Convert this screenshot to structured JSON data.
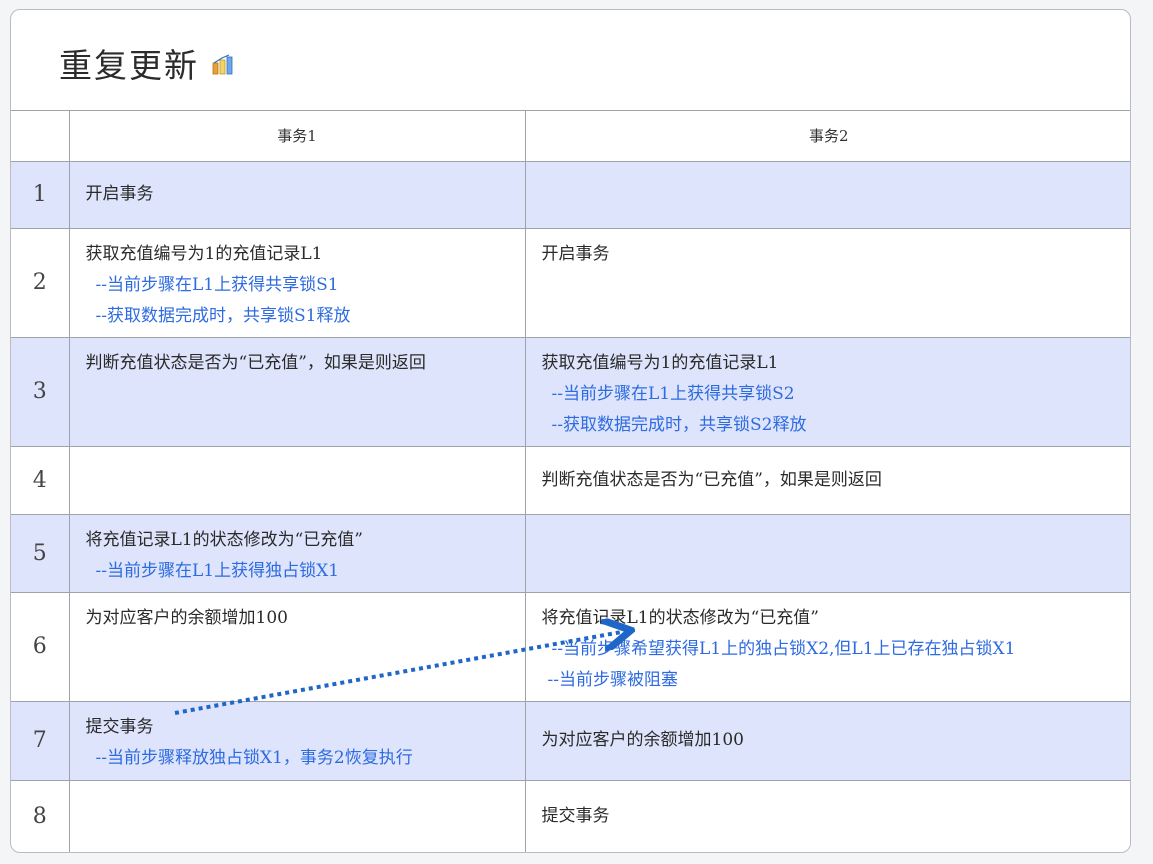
{
  "title": "重复更新",
  "title_icon": "bar-chart-icon",
  "colors": {
    "shaded_row": "#dde4fb",
    "note_text": "#2e6be0",
    "arrow": "#1f66c9"
  },
  "headers": {
    "num": "",
    "tx1": "事务1",
    "tx2": "事务2"
  },
  "rows": [
    {
      "num": "1",
      "tx1": [
        "开启事务"
      ],
      "tx2": []
    },
    {
      "num": "2",
      "tx1": [
        "获取充值编号为1的充值记录L1",
        "--当前步骤在L1上获得共享锁S1",
        "--获取数据完成时，共享锁S1释放"
      ],
      "tx2": [
        "开启事务"
      ]
    },
    {
      "num": "3",
      "tx1": [
        "判断充值状态是否为“已充值”，如果是则返回"
      ],
      "tx2": [
        "获取充值编号为1的充值记录L1",
        "--当前步骤在L1上获得共享锁S2",
        "--获取数据完成时，共享锁S2释放"
      ]
    },
    {
      "num": "4",
      "tx1": [],
      "tx2": [
        "判断充值状态是否为“已充值”，如果是则返回"
      ]
    },
    {
      "num": "5",
      "tx1": [
        "将充值记录L1的状态修改为“已充值”",
        "--当前步骤在L1上获得独占锁X1"
      ],
      "tx2": []
    },
    {
      "num": "6",
      "tx1": [
        "为对应客户的余额增加100"
      ],
      "tx2": [
        "将充值记录L1的状态修改为“已充值”",
        "--当前步骤希望获得L1上的独占锁X2,但L1上已存在独占锁X1",
        "--当前步骤被阻塞"
      ]
    },
    {
      "num": "7",
      "tx1": [
        "提交事务",
        "--当前步骤释放独占锁X1，事务2恢复执行"
      ],
      "tx2": [
        "为对应客户的余额增加100"
      ]
    },
    {
      "num": "8",
      "tx1": [],
      "tx2": [
        "提交事务"
      ]
    }
  ]
}
